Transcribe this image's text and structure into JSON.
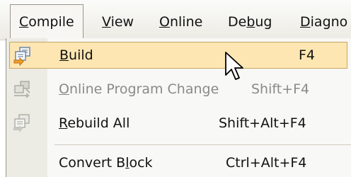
{
  "menubar": {
    "items": [
      {
        "label": "Compile",
        "mnemonic": "C"
      },
      {
        "label": "View",
        "mnemonic": "V"
      },
      {
        "label": "Online",
        "mnemonic": "O"
      },
      {
        "label": "Debug",
        "mnemonic": "b"
      },
      {
        "label": "Diagno",
        "mnemonic": "D"
      }
    ]
  },
  "compile_menu": {
    "items": [
      {
        "label": "Build",
        "shortcut": "F4",
        "icon": "build-icon",
        "state": "highlighted"
      },
      {
        "label": "Online Program Change",
        "shortcut": "Shift+F4",
        "icon": "online-program-change-icon",
        "state": "disabled"
      },
      {
        "label": "Rebuild All",
        "shortcut": "Shift+Alt+F4",
        "icon": "rebuild-all-icon",
        "state": "enabled"
      },
      {
        "label": "Convert Block",
        "shortcut": "Ctrl+Alt+F4",
        "state": "enabled"
      }
    ]
  },
  "colors": {
    "highlight_fill": "#fde6b2",
    "highlight_border": "#c7a565",
    "disabled_text": "#8a8a86",
    "gutter": "#ecebe4"
  }
}
